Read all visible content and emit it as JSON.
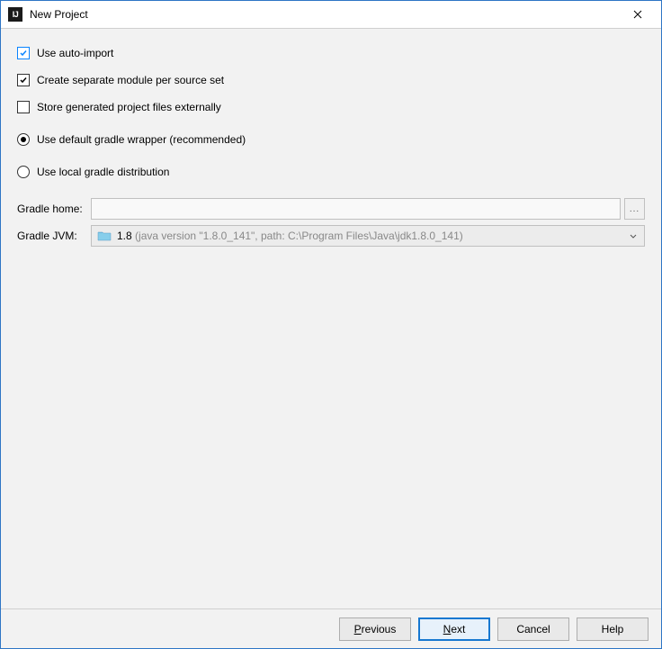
{
  "title": "New Project",
  "options": {
    "auto_import": "Use auto-import",
    "separate_module": "Create separate module per source set",
    "store_external": "Store generated project files externally",
    "default_wrapper": "Use default gradle wrapper (recommended)",
    "local_dist": "Use local gradle distribution"
  },
  "form": {
    "gradle_home_label": "Gradle home:",
    "gradle_home_value": "",
    "browse_label": "...",
    "gradle_jvm_label": "Gradle JVM:",
    "jvm_version": "1.8",
    "jvm_detail": "(java version \"1.8.0_141\", path: C:\\Program Files\\Java\\jdk1.8.0_141)"
  },
  "buttons": {
    "previous_u": "P",
    "previous_rest": "revious",
    "next_u": "N",
    "next_rest": "ext",
    "cancel": "Cancel",
    "help": "Help"
  }
}
